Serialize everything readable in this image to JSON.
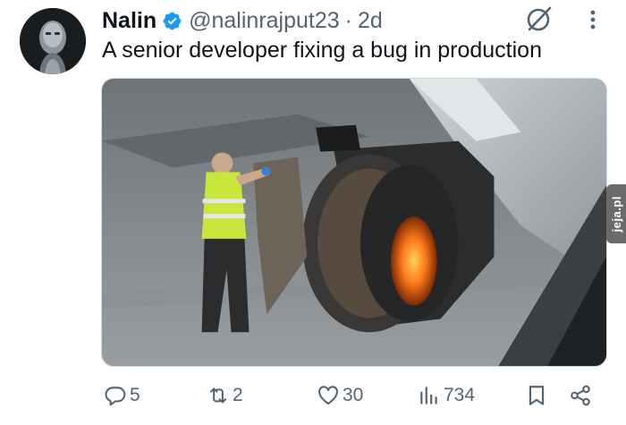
{
  "tweet": {
    "author_name": "Nalin",
    "handle": "@nalinrajput23",
    "separator": "·",
    "time": "2d",
    "text": "A senior developer fixing a bug in production",
    "verified": true,
    "avatar_icon": "robot-avatar",
    "media_watermark": "jeja.pl"
  },
  "actions": {
    "replies": "5",
    "reposts": "2",
    "likes": "30",
    "views": "734"
  },
  "colors": {
    "verified_blue": "#1d9bf0",
    "muted_text": "#536471",
    "primary_text": "#0f1419"
  }
}
